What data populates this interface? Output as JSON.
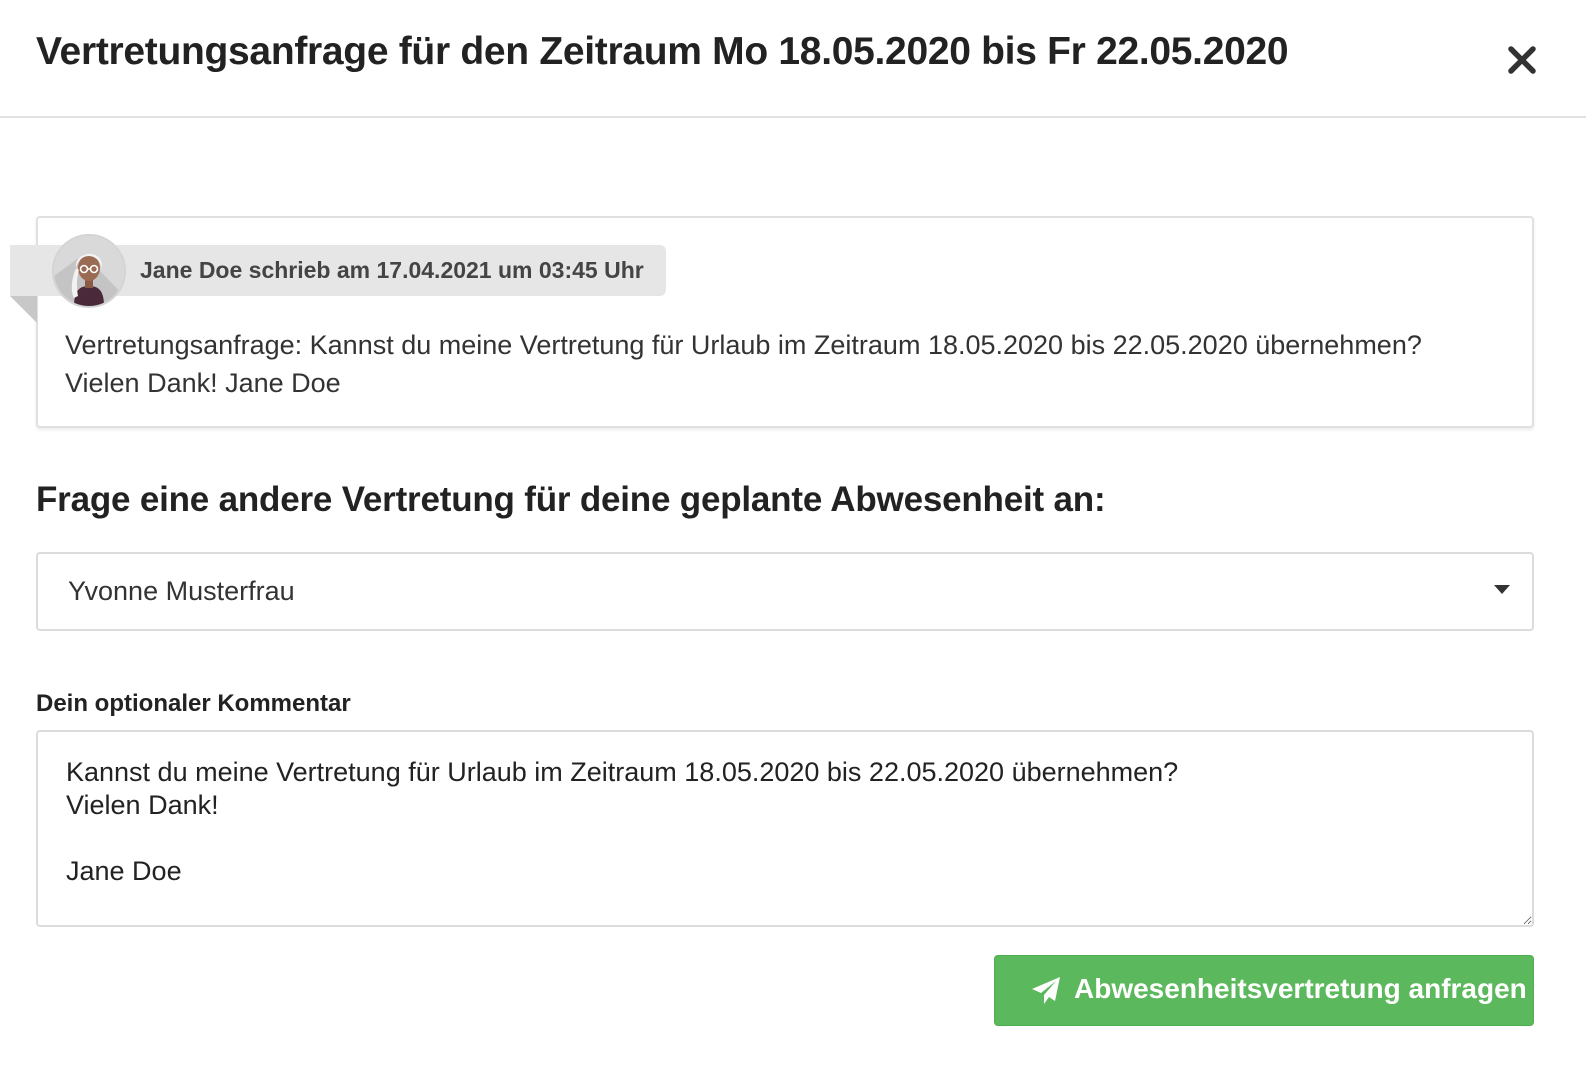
{
  "modal": {
    "title": "Vertretungsanfrage für den Zeitraum Mo 18.05.2020 bis Fr 22.05.2020",
    "close_icon": "close-icon"
  },
  "message": {
    "author_line": "Jane Doe schrieb am 17.04.2021 um 03:45 Uhr",
    "avatar_icon": "user-avatar",
    "text_line1": "Vertretungsanfrage: Kannst du meine Vertretung für Urlaub im Zeitraum 18.05.2020 bis 22.05.2020 übernehmen?",
    "text_line2": "Vielen Dank! Jane Doe"
  },
  "form": {
    "heading": "Frage eine andere Vertretung für deine geplante Abwesenheit an:",
    "substitute_select": {
      "selected": "Yvonne Musterfrau",
      "caret_icon": "caret-down-icon"
    },
    "comment_label": "Dein optionaler Kommentar",
    "comment_value": "Kannst du meine Vertretung für Urlaub im Zeitraum 18.05.2020 bis 22.05.2020 übernehmen?\nVielen Dank!\n\nJane Doe",
    "submit": {
      "label": "Abwesenheitsvertretung anfragen",
      "icon": "paper-plane-icon"
    }
  },
  "colors": {
    "accent_green": "#5cb85c",
    "text_dark": "#222222",
    "border": "#dcdcdc",
    "ribbon": "#e6e6e6"
  }
}
